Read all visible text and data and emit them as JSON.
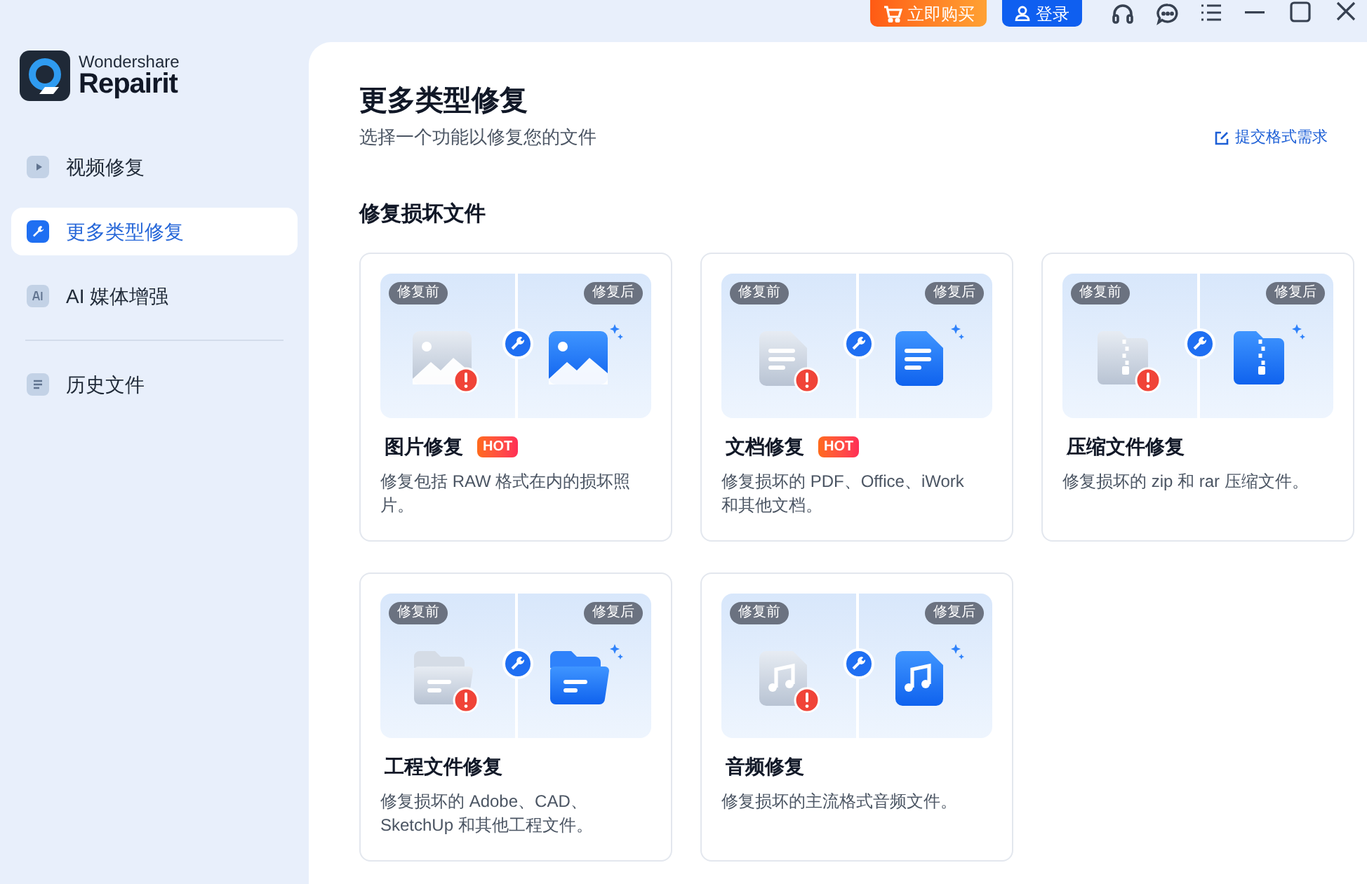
{
  "top_bar": {
    "buy_button": "立即购买",
    "login_button": "登录"
  },
  "sidebar": {
    "brand": {
      "line1": "Wondershare",
      "line2": "Repairit"
    },
    "items": [
      {
        "kind": "video",
        "label": "视频修复",
        "selected": false
      },
      {
        "kind": "wrench",
        "label": "更多类型修复",
        "selected": true
      },
      {
        "kind": "ai",
        "label": "AI 媒体增强",
        "selected": false
      }
    ],
    "secondary_items": [
      {
        "kind": "list",
        "label": "历史文件",
        "selected": false
      }
    ]
  },
  "main": {
    "title": "更多类型修复",
    "subtitle": "选择一个功能以修复您的文件",
    "request_link": "提交格式需求",
    "section_title": "修复损坏文件",
    "cards": [
      {
        "kind": "image",
        "before_label": "修复前",
        "after_label": "修复后",
        "title": "图片修复",
        "badge": "HOT",
        "description": "修复包括 RAW 格式在内的损坏照片。"
      },
      {
        "kind": "document",
        "before_label": "修复前",
        "after_label": "修复后",
        "title": "文档修复",
        "badge": "HOT",
        "description": "修复损坏的 PDF、Office、iWork 和其他文档。"
      },
      {
        "kind": "archive",
        "before_label": "修复前",
        "after_label": "修复后",
        "title": "压缩文件修复",
        "description": "修复损坏的 zip 和 rar 压缩文件。"
      },
      {
        "kind": "project",
        "before_label": "修复前",
        "after_label": "修复后",
        "title": "工程文件修复",
        "description": "修复损坏的 Adobe、CAD、SketchUp 和其他工程文件。"
      },
      {
        "kind": "audio",
        "before_label": "修复前",
        "after_label": "修复后",
        "title": "音频修复",
        "description": "修复损坏的主流格式音频文件。"
      }
    ]
  }
}
